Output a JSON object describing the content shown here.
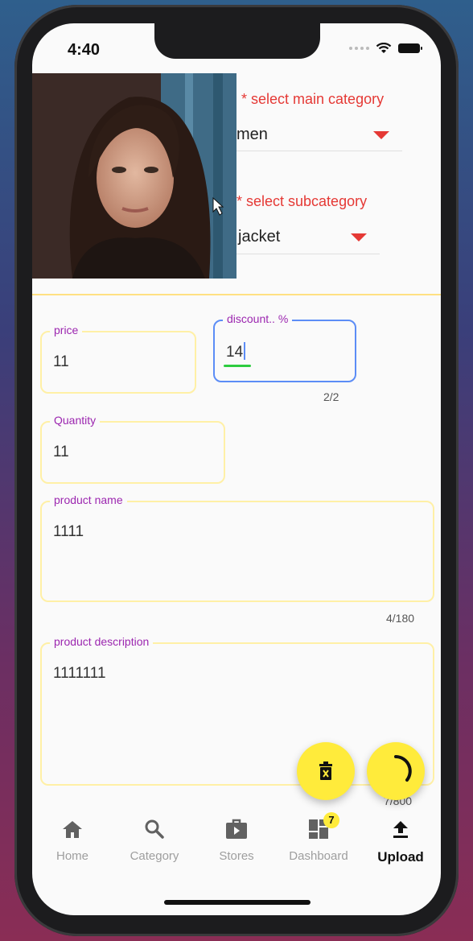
{
  "status_bar": {
    "time": "4:40"
  },
  "category": {
    "main_label": "* select main category",
    "main_value": "men",
    "sub_label": "* select subcategory",
    "sub_value": "jacket"
  },
  "fields": {
    "price": {
      "label": "price",
      "value": "11"
    },
    "discount": {
      "label": "discount.. %",
      "value": "14",
      "counter": "2/2"
    },
    "quantity": {
      "label": "Quantity",
      "value": "11"
    },
    "product_name": {
      "label": "product name",
      "value": "1111",
      "counter": "4/180"
    },
    "product_description": {
      "label": "product description",
      "value": "1111111",
      "counter": "7/800"
    }
  },
  "nav": {
    "items": [
      {
        "label": "Home",
        "icon": "home-icon"
      },
      {
        "label": "Category",
        "icon": "search-icon"
      },
      {
        "label": "Stores",
        "icon": "store-icon"
      },
      {
        "label": "Dashboard",
        "icon": "dashboard-icon",
        "badge": "7"
      },
      {
        "label": "Upload",
        "icon": "upload-icon"
      }
    ]
  },
  "colors": {
    "accent_yellow": "#ffeb3b",
    "label_purple": "#9c27b0",
    "required_red": "#e53935",
    "focus_blue": "#5c8df6"
  }
}
